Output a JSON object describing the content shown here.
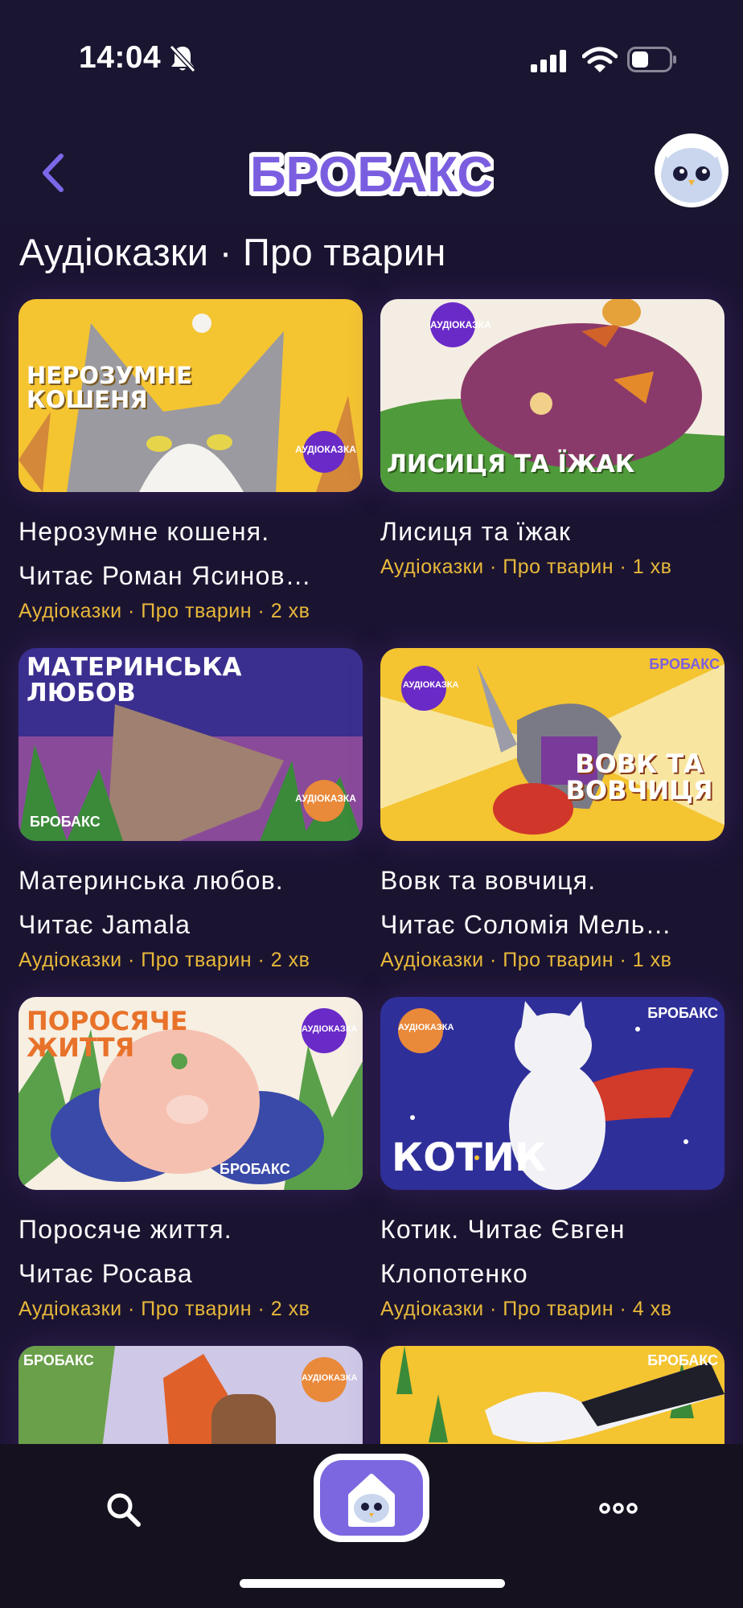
{
  "status_bar": {
    "time": "14:04"
  },
  "header": {
    "logo_text": "БРОБАКС",
    "back_icon": "chevron-left-icon",
    "avatar_icon": "owl-avatar-icon"
  },
  "page": {
    "title": "Аудіоказки · Про тварин"
  },
  "badge_text": "АУДІОКАЗКА",
  "cards": [
    {
      "cover_text": "НЕРОЗУМНЕ КОШЕНЯ",
      "title": "Нерозумне кошеня. Читає Роман Ясиновський",
      "title_line1": "Нерозумне кошеня.",
      "title_line2": "Читає Роман Ясинов…",
      "meta": "Аудіоказки · Про тварин · 2 хв"
    },
    {
      "cover_text": "ЛИСИЦЯ ТА ЇЖАК",
      "title_line1": "Лисиця та їжак",
      "title_line2": "",
      "meta": "Аудіоказки · Про тварин · 1 хв"
    },
    {
      "cover_text": "МАТЕРИНСЬКА ЛЮБОВ",
      "title_line1": "Материнська любов.",
      "title_line2": "Читає Jamala",
      "meta": "Аудіоказки · Про тварин · 2 хв"
    },
    {
      "cover_text": "ВОВК ТА ВОВЧИЦЯ",
      "title_line1": "Вовк та вовчиця.",
      "title_line2": "Читає Соломія Мель…",
      "meta": "Аудіоказки · Про тварин · 1 хв"
    },
    {
      "cover_text": "ПОРОСЯЧЕ ЖИТТЯ",
      "title_line1": "Поросяче життя.",
      "title_line2": "Читає Росава",
      "meta": "Аудіоказки · Про тварин · 2 хв"
    },
    {
      "cover_text": "КОТИК",
      "title_line1": "Котик. Читає Євген",
      "title_line2": "Клопотенко",
      "meta": "Аудіоказки · Про тварин · 4 хв"
    },
    {
      "cover_text": "",
      "title_line1": "",
      "title_line2": "",
      "meta": ""
    },
    {
      "cover_text": "",
      "title_line1": "",
      "title_line2": "",
      "meta": ""
    }
  ],
  "bottom_nav": {
    "search_icon": "search-icon",
    "home_icon": "home-owl-icon",
    "more_icon": "more-dots-icon"
  },
  "colors": {
    "background": "#1a1530",
    "accent": "#7d67e0",
    "meta": "#e8b83a"
  }
}
